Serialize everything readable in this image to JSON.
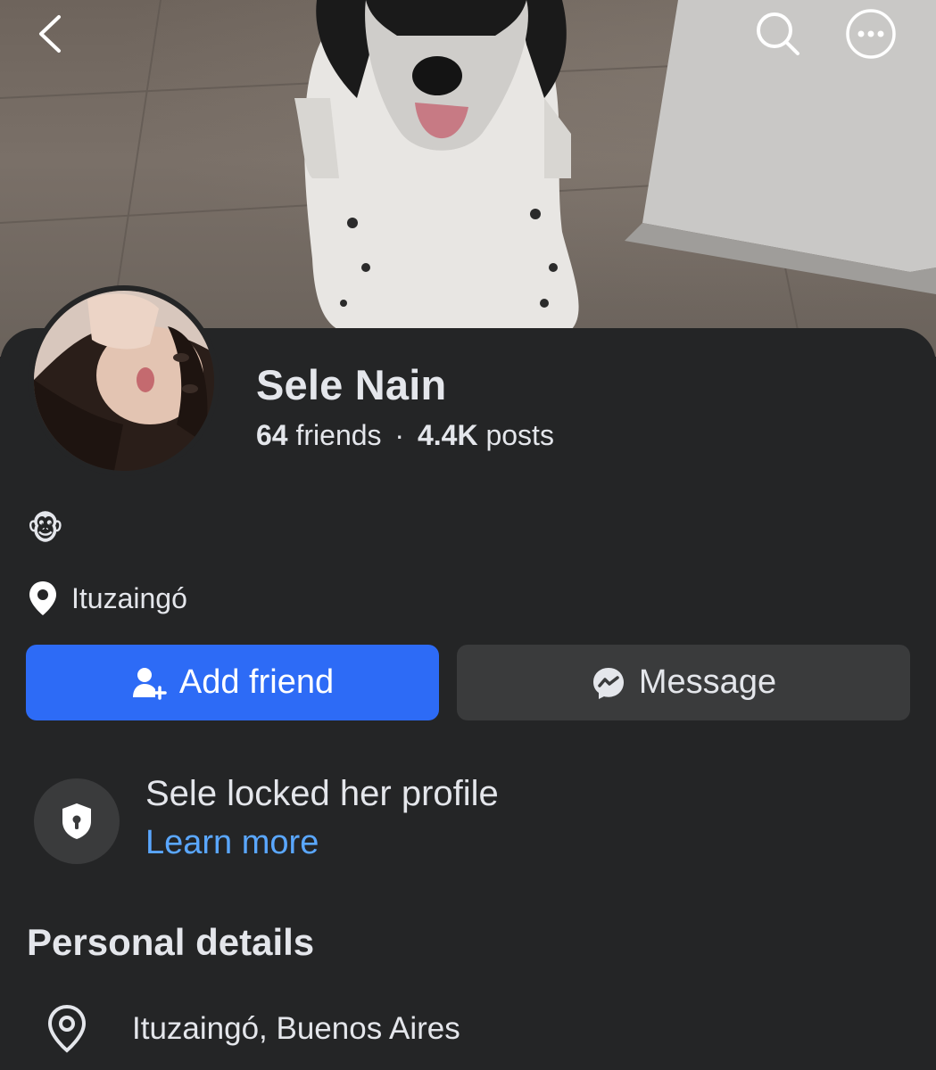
{
  "header": {
    "back_icon": "chevron-left-icon",
    "search_icon": "search-icon",
    "more_icon": "more-options-icon"
  },
  "profile": {
    "name": "Sele Nain",
    "friends_count": "64",
    "friends_label": "friends",
    "separator": "·",
    "posts_count": "4.4K",
    "posts_label": "posts",
    "bio_emoji": "🐵",
    "location": "Ituzaingó"
  },
  "actions": {
    "add_friend_label": "Add friend",
    "message_label": "Message"
  },
  "privacy": {
    "locked_text": "Sele locked her profile",
    "learn_more": "Learn more"
  },
  "personal_details": {
    "title": "Personal details",
    "location": "Ituzaingó, Buenos Aires"
  },
  "colors": {
    "background": "#242526",
    "primary_button": "#2d6bf6",
    "secondary_button": "#3a3b3c",
    "link": "#5aa7ff",
    "text": "#e4e6eb"
  }
}
